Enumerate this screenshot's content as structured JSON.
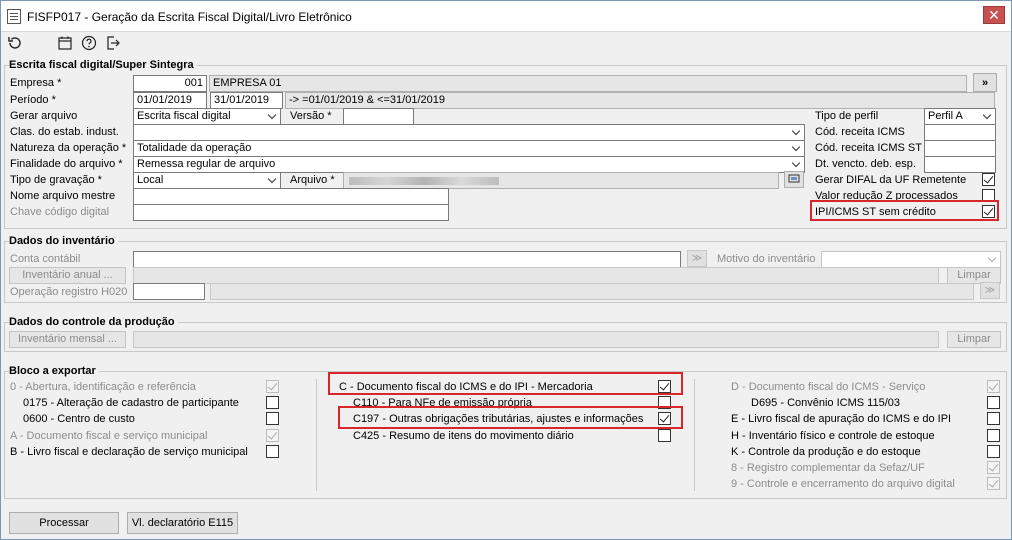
{
  "window": {
    "title": "FISFP017 - Geração da Escrita Fiscal Digital/Livro Eletrônico"
  },
  "toolbar": {
    "icons": [
      "refresh-icon",
      "calendar-icon",
      "help-icon",
      "exit-icon"
    ]
  },
  "escrita": {
    "title": "Escrita fiscal digital/Super Sintegra",
    "empresa_label": "Empresa *",
    "empresa_code": "001",
    "empresa_name": "EMPRESA 01",
    "periodo_label": "Período *",
    "periodo_start": "01/01/2019",
    "periodo_end": "31/01/2019",
    "periodo_expr": "-> =01/01/2019 & <=31/01/2019",
    "gerar_label": "Gerar arquivo",
    "gerar_value": "Escrita fiscal digital",
    "versao_label": "Versão *",
    "versao_value": "",
    "clas_label": "Clas. do estab. indust.",
    "clas_value": "",
    "natureza_label": "Natureza da operação *",
    "natureza_value": "Totalidade da operação",
    "finalidade_label": "Finalidade do arquivo *",
    "finalidade_value": "Remessa regular de arquivo",
    "tipo_grav_label": "Tipo de gravação *",
    "tipo_grav_value": "Local",
    "arquivo_label": "Arquivo *",
    "nome_mestre_label": "Nome arquivo mestre",
    "chave_label": "Chave código digital",
    "tipo_perfil_label": "Tipo de perfil",
    "tipo_perfil_value": "Perfil A",
    "cod_icms_label": "Cód. receita ICMS",
    "cod_icms_st_label": "Cód. receita ICMS ST",
    "dt_vencto_label": "Dt. vencto. deb. esp.",
    "difal_label": "Gerar DIFAL da UF Remetente",
    "valor_z_label": "Valor redução Z processados",
    "ipi_icms_label": "IPI/ICMS ST sem crédito",
    "more_button": "»"
  },
  "inventario": {
    "title": "Dados do inventário",
    "conta_label": "Conta contábil",
    "motivo_label": "Motivo do inventário",
    "anual_button": "Inventário anual ...",
    "limpar_button": "Limpar",
    "operacao_label": "Operação registro H020"
  },
  "producao": {
    "title": "Dados do controle da produção",
    "mensal_button": "Inventário mensal ...",
    "limpar_button": "Limpar"
  },
  "bloco": {
    "title": "Bloco a exportar",
    "col1": [
      {
        "label": "0 - Abertura, identificação e referência",
        "checked": true,
        "disabled": true,
        "indent": false
      },
      {
        "label": "0175 - Alteração de cadastro de participante",
        "checked": false,
        "disabled": false,
        "indent": true
      },
      {
        "label": "0600 - Centro de custo",
        "checked": false,
        "disabled": false,
        "indent": true
      },
      {
        "label": "A - Documento fiscal e serviço municipal",
        "checked": true,
        "disabled": true,
        "indent": false
      },
      {
        "label": "B - Livro fiscal e declaração de serviço municipal",
        "checked": false,
        "disabled": false,
        "indent": false
      }
    ],
    "col2": [
      {
        "label": "C - Documento fiscal do ICMS e do IPI - Mercadoria",
        "checked": true,
        "disabled": false,
        "indent": false
      },
      {
        "label": "C110 - Para NFe de emissão própria",
        "checked": false,
        "disabled": false,
        "indent": true
      },
      {
        "label": "C197 - Outras obrigações tributárias, ajustes e informações",
        "checked": true,
        "disabled": false,
        "indent": true
      },
      {
        "label": "C425 - Resumo de itens do movimento diário",
        "checked": false,
        "disabled": false,
        "indent": true
      }
    ],
    "col3": [
      {
        "label": "D - Documento fiscal do ICMS - Serviço",
        "checked": true,
        "disabled": true,
        "indent": false
      },
      {
        "label": "D695 - Convênio ICMS 115/03",
        "checked": false,
        "disabled": false,
        "indent": true
      },
      {
        "label": "E - Livro fiscal de apuração do ICMS e do IPI",
        "checked": false,
        "disabled": false,
        "indent": false
      },
      {
        "label": "H - Inventário físico e controle de estoque",
        "checked": false,
        "disabled": false,
        "indent": false
      },
      {
        "label": "K - Controle da produção e do estoque",
        "checked": false,
        "disabled": false,
        "indent": false
      },
      {
        "label": "8 - Registro complementar da Sefaz/UF",
        "checked": true,
        "disabled": true,
        "indent": false
      },
      {
        "label": "9 - Controle e encerramento do arquivo digital",
        "checked": true,
        "disabled": true,
        "indent": false
      }
    ]
  },
  "footer": {
    "processar": "Processar",
    "vl_declaratorio": "Vl. declaratório E115"
  }
}
